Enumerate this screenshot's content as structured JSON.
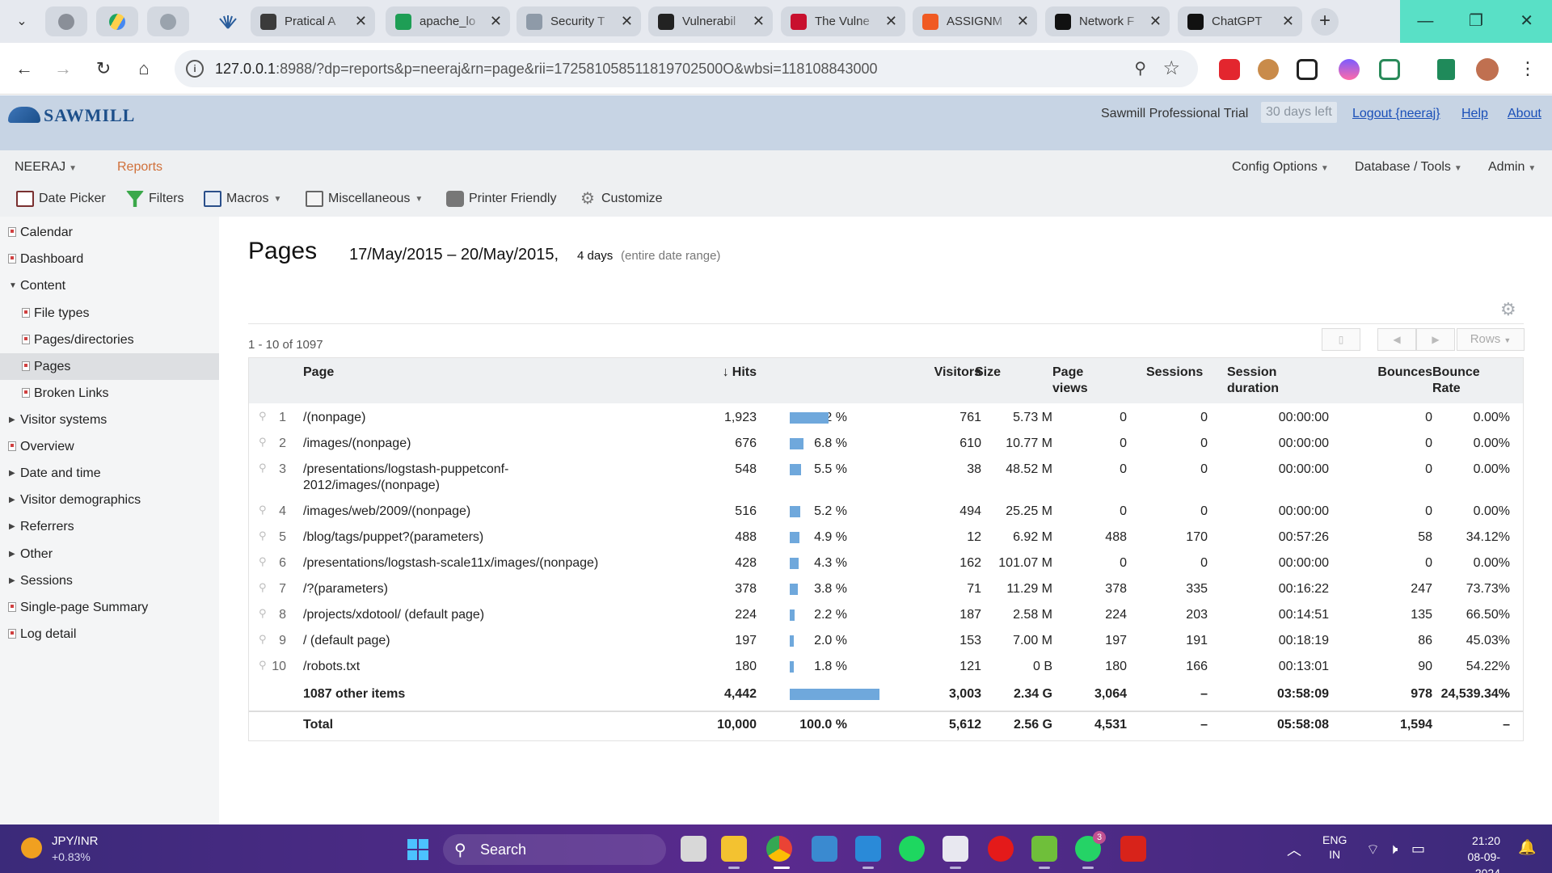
{
  "browser": {
    "tabs": [
      {
        "title": "Pratical A",
        "color": "#3b3b3b"
      },
      {
        "title": "apache_lo",
        "color": "#1e9e55"
      },
      {
        "title": "Security T",
        "color": "#8e9aa8"
      },
      {
        "title": "Vulnerabil",
        "color": "#222222"
      },
      {
        "title": "The Vulne",
        "color": "#c8102e"
      },
      {
        "title": "ASSIGNM",
        "color": "#f05a22"
      },
      {
        "title": "Network F",
        "color": "#111111"
      },
      {
        "title": "ChatGPT",
        "color": "#111111"
      }
    ],
    "url_host": "127.0.0.1",
    "url_rest": ":8988/?dp=reports&p=neeraj&rn=page&rii=172581058511819702500O&wbsi=118108843000"
  },
  "header": {
    "logo": "SAWMILL",
    "trial": "Sawmill Professional Trial",
    "days_left": "30 days left",
    "logout": "Logout {neeraj}",
    "help": "Help",
    "about": "About"
  },
  "menu": {
    "profile": "NEERAJ",
    "reports": "Reports",
    "config": "Config Options",
    "database": "Database / Tools",
    "admin": "Admin",
    "toolbar": {
      "date_picker": "Date Picker",
      "filters": "Filters",
      "macros": "Macros",
      "misc": "Miscellaneous",
      "printer": "Printer Friendly",
      "customize": "Customize"
    }
  },
  "sidebar": {
    "items": [
      {
        "label": "Calendar"
      },
      {
        "label": "Dashboard"
      },
      {
        "label": "Content"
      },
      {
        "label": "File types"
      },
      {
        "label": "Pages/directories"
      },
      {
        "label": "Pages"
      },
      {
        "label": "Broken Links"
      },
      {
        "label": "Visitor systems"
      },
      {
        "label": "Overview"
      },
      {
        "label": "Date and time"
      },
      {
        "label": "Visitor demographics"
      },
      {
        "label": "Referrers"
      },
      {
        "label": "Other"
      },
      {
        "label": "Sessions"
      },
      {
        "label": "Single-page Summary"
      },
      {
        "label": "Log detail"
      }
    ]
  },
  "report": {
    "title": "Pages",
    "date_range": "17/May/2015 – 20/May/2015,",
    "days": "4 days",
    "entire": "(entire date range)",
    "range_text": "1 - 10 of 1097",
    "rows_label": "Rows",
    "columns": {
      "page": "Page",
      "hits": "Hits",
      "visitors": "Visitors",
      "size": "Size",
      "page_views_1": "Page",
      "page_views_2": "views",
      "sessions": "Sessions",
      "session_duration_1": "Session",
      "session_duration_2": "duration",
      "bounces": "Bounces",
      "bounce_rate_1": "Bounce",
      "bounce_rate_2": "Rate"
    },
    "rows": [
      {
        "n": "1",
        "page": "/(nonpage)",
        "page2": "",
        "hits": "1,923",
        "pct": "19.2 %",
        "bar": 0.192,
        "visitors": "761",
        "size": "5.73 M",
        "pv": "0",
        "sessions": "0",
        "dur": "00:00:00",
        "bounces": "0",
        "rate": "0.00%"
      },
      {
        "n": "2",
        "page": "/images/(nonpage)",
        "page2": "",
        "hits": "676",
        "pct": "6.8 %",
        "bar": 0.068,
        "visitors": "610",
        "size": "10.77 M",
        "pv": "0",
        "sessions": "0",
        "dur": "00:00:00",
        "bounces": "0",
        "rate": "0.00%"
      },
      {
        "n": "3",
        "page": "/presentations/logstash-puppetconf-",
        "page2": "2012/images/(nonpage)",
        "hits": "548",
        "pct": "5.5 %",
        "bar": 0.055,
        "visitors": "38",
        "size": "48.52 M",
        "pv": "0",
        "sessions": "0",
        "dur": "00:00:00",
        "bounces": "0",
        "rate": "0.00%"
      },
      {
        "n": "4",
        "page": "/images/web/2009/(nonpage)",
        "page2": "",
        "hits": "516",
        "pct": "5.2 %",
        "bar": 0.052,
        "visitors": "494",
        "size": "25.25 M",
        "pv": "0",
        "sessions": "0",
        "dur": "00:00:00",
        "bounces": "0",
        "rate": "0.00%"
      },
      {
        "n": "5",
        "page": "/blog/tags/puppet?(parameters)",
        "page2": "",
        "hits": "488",
        "pct": "4.9 %",
        "bar": 0.049,
        "visitors": "12",
        "size": "6.92 M",
        "pv": "488",
        "sessions": "170",
        "dur": "00:57:26",
        "bounces": "58",
        "rate": "34.12%"
      },
      {
        "n": "6",
        "page": "/presentations/logstash-scale11x/images/(nonpage)",
        "page2": "",
        "hits": "428",
        "pct": "4.3 %",
        "bar": 0.043,
        "visitors": "162",
        "size": "101.07 M",
        "pv": "0",
        "sessions": "0",
        "dur": "00:00:00",
        "bounces": "0",
        "rate": "0.00%"
      },
      {
        "n": "7",
        "page": "/?(parameters)",
        "page2": "",
        "hits": "378",
        "pct": "3.8 %",
        "bar": 0.038,
        "visitors": "71",
        "size": "11.29 M",
        "pv": "378",
        "sessions": "335",
        "dur": "00:16:22",
        "bounces": "247",
        "rate": "73.73%"
      },
      {
        "n": "8",
        "page": "/projects/xdotool/ (default page)",
        "page2": "",
        "hits": "224",
        "pct": "2.2 %",
        "bar": 0.022,
        "visitors": "187",
        "size": "2.58 M",
        "pv": "224",
        "sessions": "203",
        "dur": "00:14:51",
        "bounces": "135",
        "rate": "66.50%"
      },
      {
        "n": "9",
        "page": "/ (default page)",
        "page2": "",
        "hits": "197",
        "pct": "2.0 %",
        "bar": 0.02,
        "visitors": "153",
        "size": "7.00 M",
        "pv": "197",
        "sessions": "191",
        "dur": "00:18:19",
        "bounces": "86",
        "rate": "45.03%"
      },
      {
        "n": "10",
        "page": "/robots.txt",
        "page2": "",
        "hits": "180",
        "pct": "1.8 %",
        "bar": 0.018,
        "visitors": "121",
        "size": "0 B",
        "pv": "180",
        "sessions": "166",
        "dur": "00:13:01",
        "bounces": "90",
        "rate": "54.22%"
      }
    ],
    "other": {
      "page": "1087 other items",
      "hits": "4,442",
      "pct": "44.4 %",
      "bar": 0.444,
      "visitors": "3,003",
      "size": "2.34 G",
      "pv": "3,064",
      "sessions": "–",
      "dur": "03:58:09",
      "bounces": "978",
      "rate": "24,539.34%"
    },
    "total": {
      "page": "Total",
      "hits": "10,000",
      "pct": "100.0 %",
      "visitors": "5,612",
      "size": "2.56 G",
      "pv": "4,531",
      "sessions": "–",
      "dur": "05:58:08",
      "bounces": "1,594",
      "rate": "–"
    }
  },
  "taskbar": {
    "ticker_symbol": "JPY/INR",
    "ticker_change": "+0.83%",
    "search": "Search",
    "whatsapp_badge": "3",
    "lang1": "ENG",
    "lang2": "IN",
    "time": "21:20",
    "date": "08-09-2024"
  }
}
